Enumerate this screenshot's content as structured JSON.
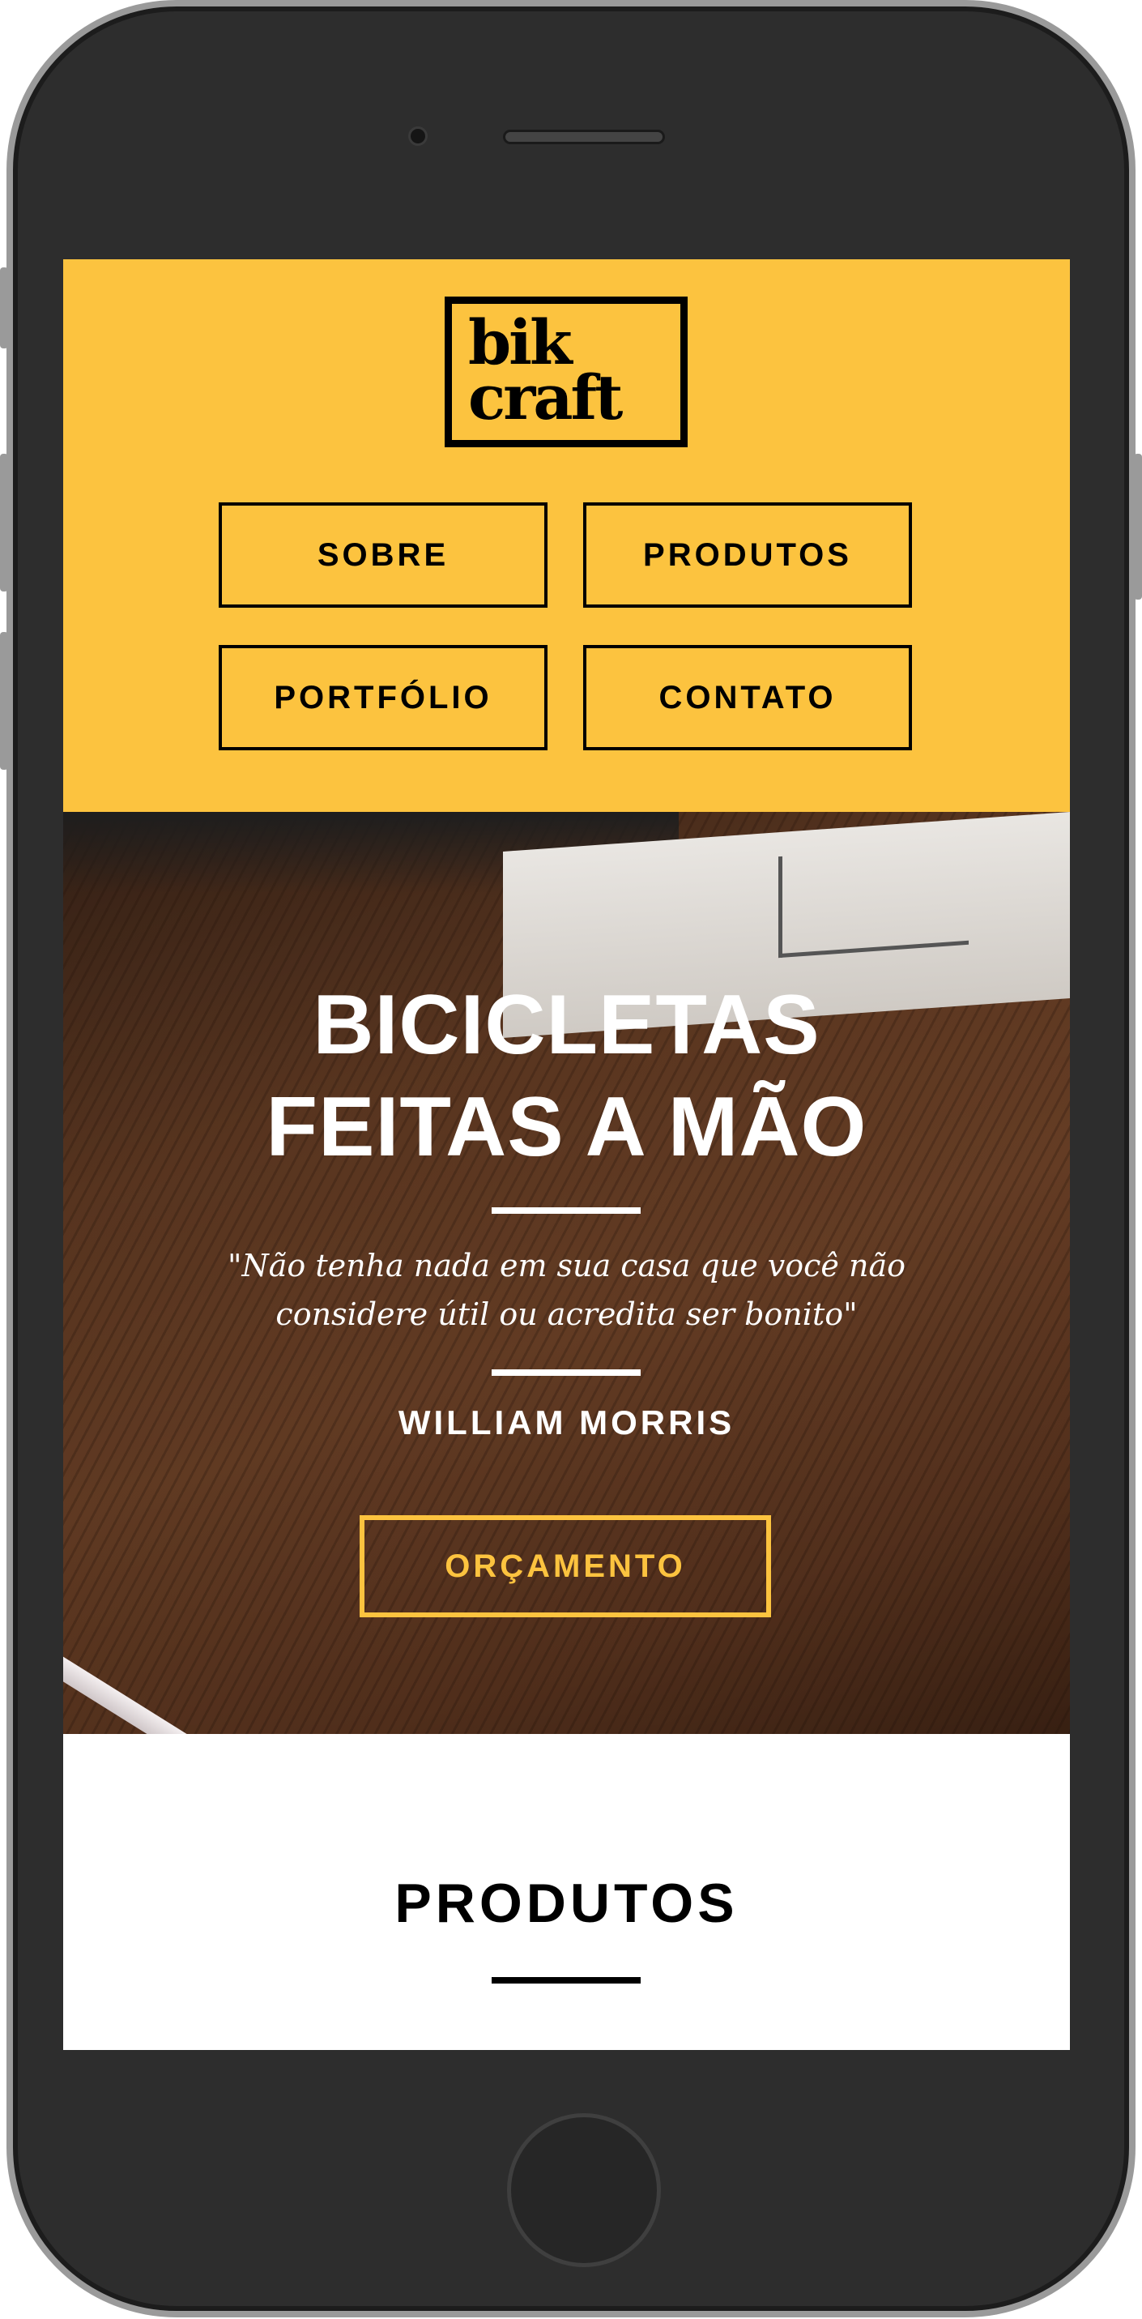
{
  "logo": {
    "line1": "bik",
    "line2": "craft"
  },
  "nav": {
    "items": [
      {
        "label": "SOBRE"
      },
      {
        "label": "PRODUTOS"
      },
      {
        "label": "PORTFÓLIO"
      },
      {
        "label": "CONTATO"
      }
    ]
  },
  "hero": {
    "title_line1": "BICICLETAS",
    "title_line2": "FEITAS A MÃO",
    "quote": "\"Não tenha nada em sua casa que você não considere útil ou acredita ser bonito\"",
    "author": "WILLIAM MORRIS",
    "cta_label": "ORÇAMENTO"
  },
  "section": {
    "title": "PRODUTOS"
  },
  "colors": {
    "accent": "#fcc33f",
    "text": "#000000",
    "on_image": "#ffffff"
  }
}
